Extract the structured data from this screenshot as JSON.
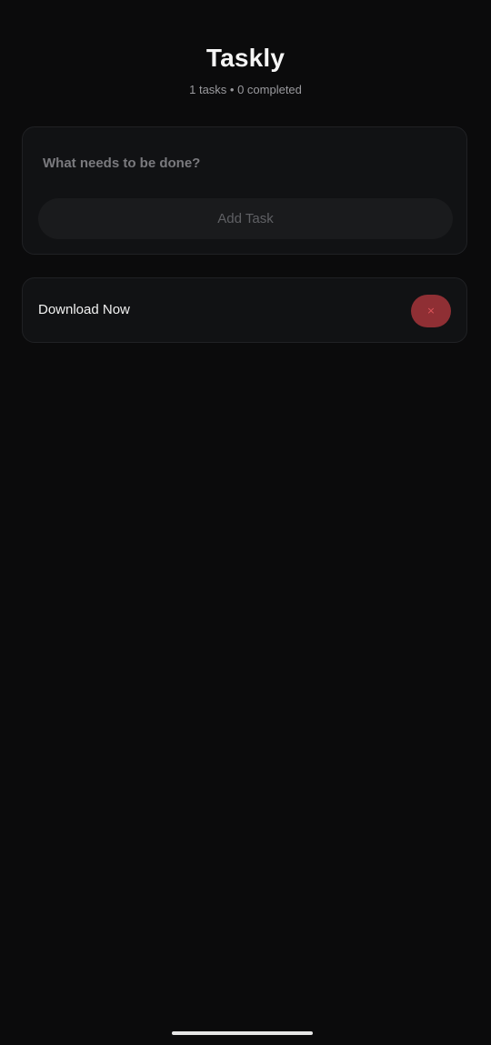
{
  "header": {
    "title": "Taskly",
    "subtitle": "1 tasks • 0 completed"
  },
  "composer": {
    "input_value": "",
    "input_placeholder": "What needs to be done?",
    "add_label": "Add Task"
  },
  "tasks": [
    {
      "text": "Download Now",
      "delete_icon": "×"
    }
  ],
  "colors": {
    "background": "#0b0b0c",
    "card": "#111214",
    "delete_button": "#8f2f34",
    "delete_icon": "#e0565b"
  },
  "icons": {
    "delete": "close-icon"
  }
}
